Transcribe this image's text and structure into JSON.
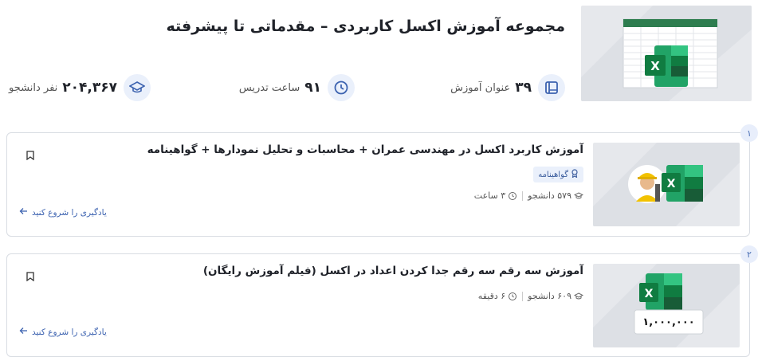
{
  "hero": {
    "title": "مجموعه آموزش اکسل کاربردی – مقدماتی تا پیشرفته",
    "stats": {
      "lessons_value": "۳۹",
      "lessons_label": "عنوان آموزش",
      "hours_value": "۹۱",
      "hours_label": "ساعت تدریس",
      "students_value": "۲۰۴,۳۶۷",
      "students_label": "نفر دانشجو"
    }
  },
  "courses": [
    {
      "index": "۱",
      "title": "آموزش کاربرد اکسل در مهندسی عمران + محاسبات و تحلیل نمودارها + گواهینامه",
      "certificate": "گواهینامه",
      "students": "۵۷۹ دانشجو",
      "duration": "۳ ساعت",
      "start_label": "یادگیری را شروع کنید"
    },
    {
      "index": "۲",
      "title": "آموزش سه رقم سه رقم جدا کردن اعداد در اکسل (فیلم آموزش رایگان)",
      "students": "۶۰۹ دانشجو",
      "duration": "۶ دقیقه",
      "start_label": "یادگیری را شروع کنید",
      "thumb_number": "۱,۰۰۰,۰۰۰"
    }
  ],
  "colors": {
    "accent": "#3d63b0",
    "excel_green": "#1d7a45",
    "badge_bg": "#eaf0fb"
  }
}
